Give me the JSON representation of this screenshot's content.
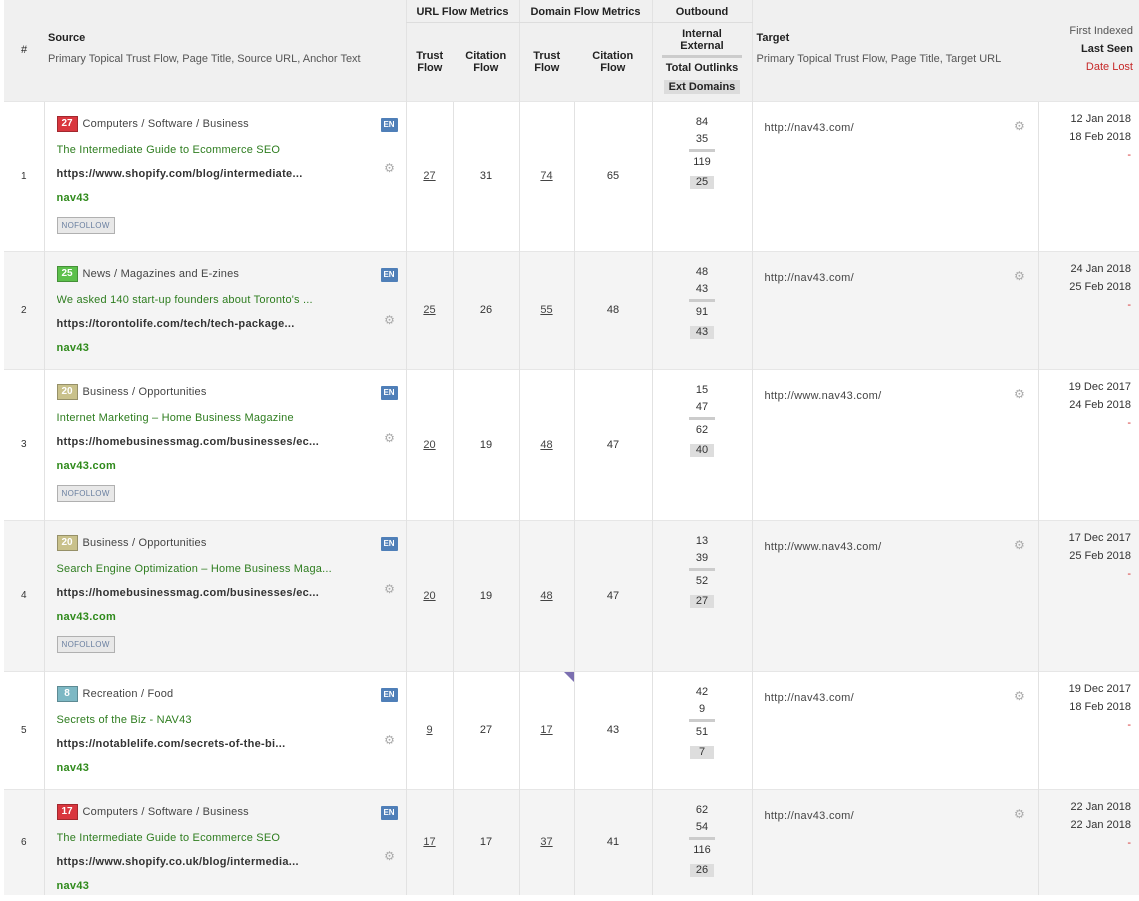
{
  "header": {
    "index": "#",
    "source_title": "Source",
    "source_sub": "Primary Topical Trust Flow, Page Title, Source URL, Anchor Text",
    "url_flow_metrics": "URL Flow Metrics",
    "domain_flow_metrics": "Domain Flow Metrics",
    "outbound": "Outbound",
    "trust_flow_line1": "Trust",
    "trust_flow_line2": "Flow",
    "citation_flow_line1": "Citation",
    "citation_flow_line2": "Flow",
    "internal": "Internal",
    "external": "External",
    "total_outlinks": "Total Outlinks",
    "ext_domains": "Ext Domains",
    "target_title": "Target",
    "target_sub": "Primary Topical Trust Flow, Page Title, Target URL",
    "first_indexed": "First Indexed",
    "last_seen": "Last Seen",
    "date_lost": "Date Lost"
  },
  "colors": {
    "tf_red": "#d9363e",
    "tf_green": "#5cc04b",
    "tf_olive": "#c9c18b",
    "tf_teal": "#7db8c4",
    "accent_green": "#2e7d1f",
    "lost_red": "#d32f2f"
  },
  "icons": {
    "settings": "gear-icon"
  },
  "rows": [
    {
      "index": "1",
      "tf": "27",
      "tf_color": "#d9363e",
      "topic": "Computers / Software / Business",
      "lang": "EN",
      "title": "The Intermediate Guide to Ecommerce SEO",
      "url": "https://www.shopify.com/blog/intermediate...",
      "anchor": "nav43",
      "nofollow": "NOFOLLOW",
      "url_tf": "27",
      "url_cf": "31",
      "dom_tf": "74",
      "dom_cf": "65",
      "internal": "84",
      "external": "35",
      "total": "119",
      "ext_domains": "25",
      "target": "http://nav43.com/",
      "first_indexed": "12 Jan 2018",
      "last_seen": "18 Feb 2018",
      "date_lost": "-"
    },
    {
      "index": "2",
      "tf": "25",
      "tf_color": "#5cc04b",
      "topic": "News / Magazines and E-zines",
      "lang": "EN",
      "title": "We asked 140 start-up founders about Toronto's ...",
      "url": "https://torontolife.com/tech/tech-package...",
      "anchor": "nav43",
      "nofollow": "",
      "url_tf": "25",
      "url_cf": "26",
      "dom_tf": "55",
      "dom_cf": "48",
      "internal": "48",
      "external": "43",
      "total": "91",
      "ext_domains": "43",
      "target": "http://nav43.com/",
      "first_indexed": "24 Jan 2018",
      "last_seen": "25 Feb 2018",
      "date_lost": "-"
    },
    {
      "index": "3",
      "tf": "20",
      "tf_color": "#c9c18b",
      "topic": "Business / Opportunities",
      "lang": "EN",
      "title": "Internet Marketing – Home Business Magazine",
      "url": "https://homebusinessmag.com/businesses/ec...",
      "anchor": "nav43.com",
      "nofollow": "NOFOLLOW",
      "url_tf": "20",
      "url_cf": "19",
      "dom_tf": "48",
      "dom_cf": "47",
      "internal": "15",
      "external": "47",
      "total": "62",
      "ext_domains": "40",
      "target": "http://www.nav43.com/",
      "first_indexed": "19 Dec 2017",
      "last_seen": "24 Feb 2018",
      "date_lost": "-"
    },
    {
      "index": "4",
      "tf": "20",
      "tf_color": "#c9c18b",
      "topic": "Business / Opportunities",
      "lang": "EN",
      "title": "Search Engine Optimization – Home Business Maga...",
      "url": "https://homebusinessmag.com/businesses/ec...",
      "anchor": "nav43.com",
      "nofollow": "NOFOLLOW",
      "url_tf": "20",
      "url_cf": "19",
      "dom_tf": "48",
      "dom_cf": "47",
      "internal": "13",
      "external": "39",
      "total": "52",
      "ext_domains": "27",
      "target": "http://www.nav43.com/",
      "first_indexed": "17 Dec 2017",
      "last_seen": "25 Feb 2018",
      "date_lost": "-"
    },
    {
      "index": "5",
      "tf": "8",
      "tf_color": "#7db8c4",
      "topic": "Recreation / Food",
      "lang": "EN",
      "title": "Secrets of the Biz - NAV43",
      "url": "https://notablelife.com/secrets-of-the-bi...",
      "anchor": "nav43",
      "nofollow": "",
      "url_tf": "9",
      "url_cf": "27",
      "dom_tf": "17",
      "dom_cf": "43",
      "internal": "42",
      "external": "9",
      "total": "51",
      "ext_domains": "7",
      "target": "http://nav43.com/",
      "first_indexed": "19 Dec 2017",
      "last_seen": "18 Feb 2018",
      "date_lost": "-"
    },
    {
      "index": "6",
      "tf": "17",
      "tf_color": "#d9363e",
      "topic": "Computers / Software / Business",
      "lang": "EN",
      "title": "The Intermediate Guide to Ecommerce SEO",
      "url": "https://www.shopify.co.uk/blog/intermedia...",
      "anchor": "nav43",
      "nofollow": "",
      "url_tf": "17",
      "url_cf": "17",
      "dom_tf": "37",
      "dom_cf": "41",
      "internal": "62",
      "external": "54",
      "total": "116",
      "ext_domains": "26",
      "target": "http://nav43.com/",
      "first_indexed": "22 Jan 2018",
      "last_seen": "22 Jan 2018",
      "date_lost": "-"
    }
  ]
}
